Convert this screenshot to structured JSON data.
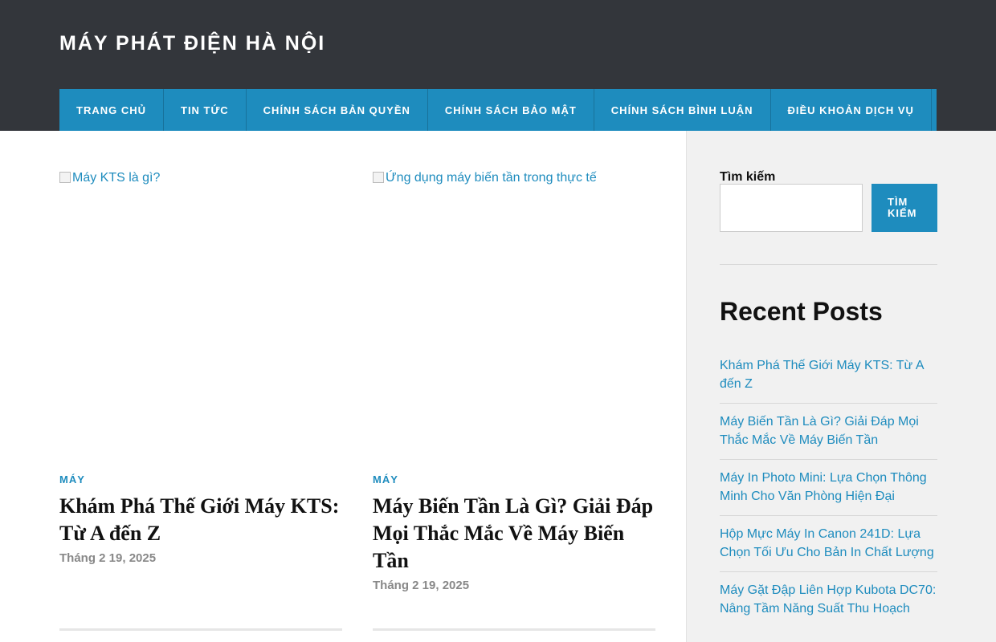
{
  "site": {
    "title": "MÁY PHÁT ĐIỆN HÀ NỘI"
  },
  "nav": {
    "items": [
      {
        "label": "Trang chủ"
      },
      {
        "label": "Tin tức"
      },
      {
        "label": "Chính sách bản quyền"
      },
      {
        "label": "Chính sách bảo mật"
      },
      {
        "label": "Chính sách bình luận"
      },
      {
        "label": "Điều khoản dịch vụ"
      }
    ]
  },
  "posts": [
    {
      "thumb_alt": "Máy KTS là gì?",
      "category": "Máy",
      "title": "Khám Phá Thế Giới Máy KTS: Từ A đến Z",
      "date": "Tháng 2 19, 2025"
    },
    {
      "thumb_alt": "Ứng dụng máy biến tần trong thực tế",
      "category": "Máy",
      "title": "Máy Biến Tần Là Gì? Giải Đáp Mọi Thắc Mắc Về Máy Biến Tần",
      "date": "Tháng 2 19, 2025"
    }
  ],
  "sidebar": {
    "search_label": "Tìm kiếm",
    "search_value": "",
    "search_button": "Tìm kiếm",
    "recent_title": "Recent Posts",
    "recent_posts": [
      {
        "label": "Khám Phá Thế Giới Máy KTS: Từ A đến Z"
      },
      {
        "label": "Máy Biến Tần Là Gì? Giải Đáp Mọi Thắc Mắc Về Máy Biến Tần"
      },
      {
        "label": "Máy In Photo Mini: Lựa Chọn Thông Minh Cho Văn Phòng Hiện Đại"
      },
      {
        "label": "Hộp Mực Máy In Canon 241D: Lựa Chọn Tối Ưu Cho Bản In Chất Lượng"
      },
      {
        "label": "Máy Gặt Đập Liên Hợp Kubota DC70: Nâng Tầm Năng Suất Thu Hoạch"
      }
    ]
  },
  "colors": {
    "header_bg": "#33363b",
    "accent": "#1e8cbe",
    "sidebar_bg": "#f1f1f1"
  }
}
